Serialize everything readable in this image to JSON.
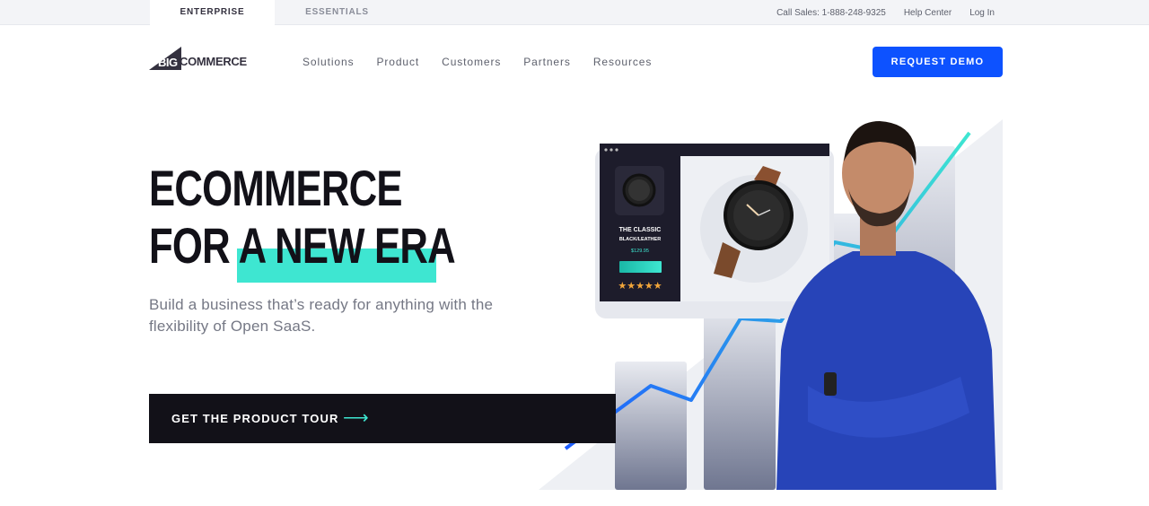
{
  "utility_bar": {
    "tabs": [
      {
        "label": "ENTERPRISE",
        "active": true
      },
      {
        "label": "ESSENTIALS",
        "active": false
      }
    ],
    "call_sales": "Call Sales: 1-888-248-9325",
    "help_center": "Help Center",
    "log_in": "Log In"
  },
  "nav": {
    "logo": {
      "big": "BIG",
      "commerce": "COMMERCE"
    },
    "links": [
      "Solutions",
      "Product",
      "Customers",
      "Partners",
      "Resources"
    ],
    "cta": "REQUEST DEMO"
  },
  "hero": {
    "title_line1": "ECOMMERCE",
    "title_line2": "FOR A NEW ERA",
    "subtitle": "Build a business that’s ready for anything with the flexibility of Open SaaS.",
    "cta": "GET THE PRODUCT TOUR",
    "cta_icon": "⟶"
  },
  "product_card": {
    "name": "THE CLASSIC",
    "variant": "BLACK/LEATHER",
    "price": "$129.95",
    "rating": 5,
    "stars": "★★★★★"
  },
  "colors": {
    "brand_blue": "#0d52ff",
    "accent_teal": "#3ee6d1",
    "dark": "#121118",
    "shirt_blue": "#2744b8"
  }
}
